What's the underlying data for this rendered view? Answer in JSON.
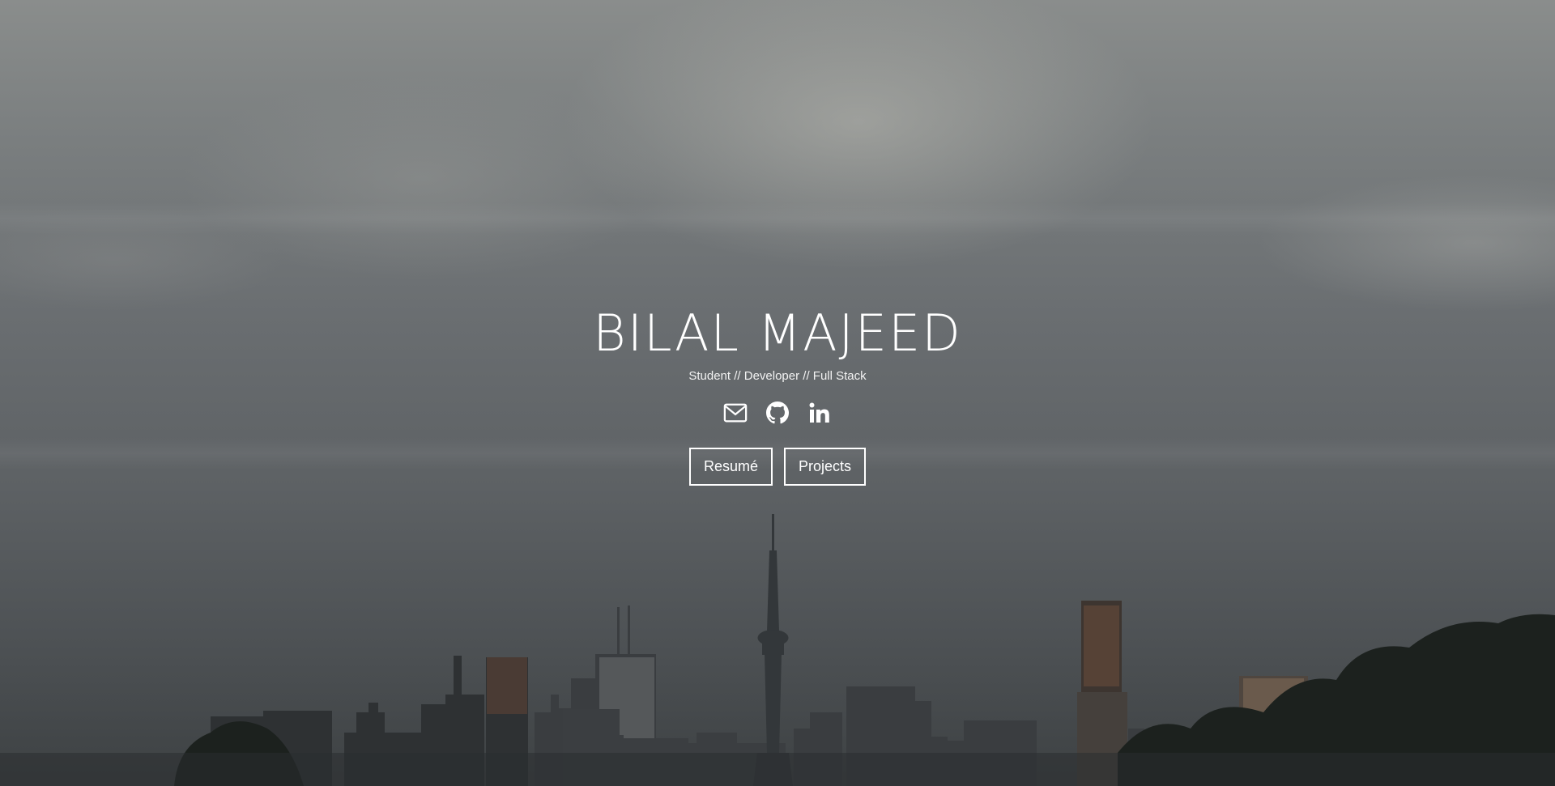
{
  "hero": {
    "name": "BILAL MAJEED",
    "tagline": "Student // Developer // Full Stack"
  },
  "social": [
    {
      "icon": "envelope-icon",
      "label": "Email"
    },
    {
      "icon": "github-icon",
      "label": "GitHub"
    },
    {
      "icon": "linkedin-icon",
      "label": "LinkedIn"
    }
  ],
  "buttons": {
    "resume_label": "Resumé",
    "projects_label": "Projects"
  },
  "colors": {
    "text": "#ffffff",
    "sky": "#6a6e71"
  }
}
